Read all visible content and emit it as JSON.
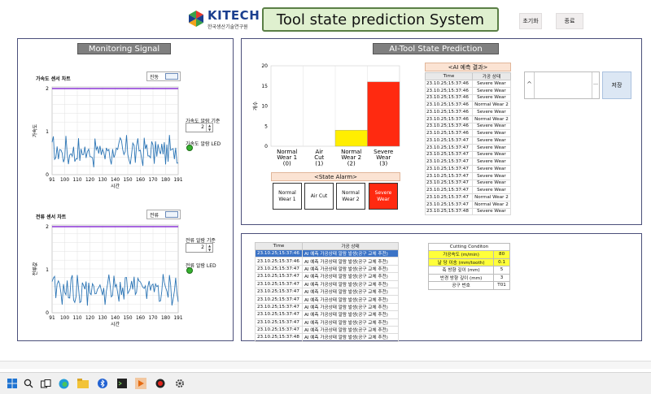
{
  "header": {
    "logo_name": "KITECH",
    "logo_sub": "한국생산기술연구원",
    "title": "Tool state prediction System",
    "reset_label": "초기화",
    "exit_label": "종료"
  },
  "monitoring": {
    "title": "Monitoring Signal",
    "accel": {
      "chart_title": "가속도 센서 차트",
      "mode": "진동",
      "y_label": "가속도",
      "x_label": "시간",
      "y_ticks": [
        "2",
        "1",
        "0"
      ],
      "x_ticks": [
        "91",
        "100",
        "110",
        "120",
        "130",
        "140",
        "150",
        "160",
        "170",
        "180",
        "191"
      ],
      "alarm_label": "가속도 알람 기준",
      "alarm_value": "2",
      "led_label": "가속도 알람 LED"
    },
    "current": {
      "chart_title": "전류 센서 차트",
      "mode": "전류",
      "y_label": "전류값",
      "x_label": "시간",
      "y_ticks": [
        "2",
        "1",
        "0"
      ],
      "x_ticks": [
        "91",
        "100",
        "110",
        "120",
        "130",
        "140",
        "150",
        "160",
        "170",
        "180",
        "191"
      ],
      "alarm_label": "전류 알람 기준",
      "alarm_value": "2",
      "led_label": "전류 알람 LED"
    }
  },
  "prediction": {
    "title": "AI-Tool State Prediction",
    "y_axis_label": "개수",
    "result_title": "<AI 예측 결과>",
    "result_columns": [
      "Time",
      "가공 상태"
    ],
    "results": [
      [
        "23.10.25;15:37:46",
        "Severe Wear"
      ],
      [
        "23.10.25;15:37:46",
        "Severe Wear"
      ],
      [
        "23.10.25;15:37:46",
        "Severe Wear"
      ],
      [
        "23.10.25;15:37:46",
        "Normal Wear 2"
      ],
      [
        "23.10.25;15:37:46",
        "Severe Wear"
      ],
      [
        "23.10.25;15:37:46",
        "Normal Wear 2"
      ],
      [
        "23.10.25;15:37:46",
        "Severe Wear"
      ],
      [
        "23.10.25;15:37:46",
        "Severe Wear"
      ],
      [
        "23.10.25;15:37:47",
        "Severe Wear"
      ],
      [
        "23.10.25;15:37:47",
        "Severe Wear"
      ],
      [
        "23.10.25;15:37:47",
        "Severe Wear"
      ],
      [
        "23.10.25;15:37:47",
        "Severe Wear"
      ],
      [
        "23.10.25;15:37:47",
        "Severe Wear"
      ],
      [
        "23.10.25;15:37:47",
        "Severe Wear"
      ],
      [
        "23.10.25;15:37:47",
        "Severe Wear"
      ],
      [
        "23.10.25;15:37:47",
        "Severe Wear"
      ],
      [
        "23.10.25;15:37:47",
        "Normal Wear 2"
      ],
      [
        "23.10.25;15:37:47",
        "Normal Wear 2"
      ],
      [
        "23.10.25;15:37:48",
        "Severe Wear"
      ]
    ],
    "alarm_title": "<State Alarm>",
    "alarms": [
      "Normal Wear 1",
      "Air Cut",
      "Normal Wear 2",
      "Severe Wear"
    ],
    "save_label": "저장",
    "colors": {
      "normal_wear_2": "#ffee00",
      "severe_wear": "#ff2a10",
      "alarm_active": "#ff2a10"
    }
  },
  "chart_data": {
    "type": "bar",
    "categories": [
      "Normal Wear 1 (0)",
      "Air Cut (1)",
      "Normal Wear 2 (2)",
      "Severe Wear (3)"
    ],
    "category_lines": [
      [
        "Normal",
        "Wear 1",
        "(0)"
      ],
      [
        "Air",
        "Cut",
        "(1)"
      ],
      [
        "Normal",
        "Wear 2",
        "(2)"
      ],
      [
        "Severe",
        "Wear",
        "(3)"
      ]
    ],
    "values": [
      0,
      0,
      4,
      16
    ],
    "colors": [
      "#ffffff",
      "#ffffff",
      "#ffee00",
      "#ff2a10"
    ],
    "ylabel": "개수",
    "ylim": [
      0,
      20
    ],
    "y_ticks": [
      0,
      5,
      10,
      15,
      20
    ]
  },
  "history": {
    "columns": [
      "Time",
      "가공 상태"
    ],
    "rows": [
      [
        "23.10.25;15:37:46",
        "AI 예측 가공상태 알람 발생(공구 교체 추천)"
      ],
      [
        "23.10.25;15:37:46",
        "AI 예측 가공상태 알람 발생(공구 교체 추천)"
      ],
      [
        "23.10.25;15:37:47",
        "AI 예측 가공상태 알람 발생(공구 교체 추천)"
      ],
      [
        "23.10.25;15:37:47",
        "AI 예측 가공상태 알람 발생(공구 교체 추천)"
      ],
      [
        "23.10.25;15:37:47",
        "AI 예측 가공상태 알람 발생(공구 교체 추천)"
      ],
      [
        "23.10.25;15:37:47",
        "AI 예측 가공상태 알람 발생(공구 교체 추천)"
      ],
      [
        "23.10.25;15:37:47",
        "AI 예측 가공상태 알람 발생(공구 교체 추천)"
      ],
      [
        "23.10.25;15:37:47",
        "AI 예측 가공상태 알람 발생(공구 교체 추천)"
      ],
      [
        "23.10.25;15:37:47",
        "AI 예측 가공상태 알람 발생(공구 교체 추천)"
      ],
      [
        "23.10.25;15:37:47",
        "AI 예측 가공상태 알람 발생(공구 교체 추천)"
      ],
      [
        "23.10.25;15:37:47",
        "AI 예측 가공상태 알람 발생(공구 교체 추천)"
      ],
      [
        "23.10.25;15:37:48",
        "AI 예측 가공상태 알람 발생(공구 교체 추천)"
      ]
    ]
  },
  "cutting": {
    "title": "Cutting Conditon",
    "rows": [
      [
        "가공속도 (m/min)",
        "80"
      ],
      [
        "날 당 이송 (mm/tooth)",
        "0.1"
      ],
      [
        "축 방향 깊이 (mm)",
        "5"
      ],
      [
        "반경 방향 깊이 (mm)",
        "3"
      ],
      [
        "공구 번호",
        "T01"
      ]
    ]
  },
  "taskbar": {
    "icons": [
      "windows-start-icon",
      "search-icon",
      "task-view-icon",
      "edge-browser-icon",
      "file-explorer-icon",
      "bluetooth-icon",
      "terminal-icon",
      "media-icon",
      "record-icon",
      "settings-icon"
    ]
  }
}
